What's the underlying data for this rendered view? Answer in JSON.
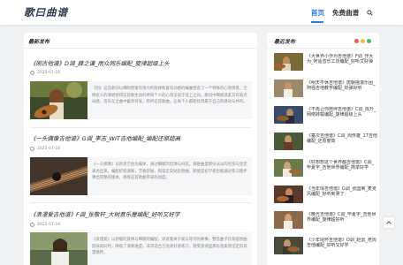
{
  "header": {
    "logo": "歌曰曲谱",
    "nav_home": "首页",
    "nav_free": "免费曲谱"
  },
  "main": {
    "section_title": "最新发布",
    "posts": [
      {
        "title": "《刚古他谱》D调_薛之谦_雨众同乐编配_旋律超级上头",
        "date": "2025-07-16",
        "excerpt": "《别》这首歌词以细的而富有张力的旋律和富有动感的编曲营造了一个特殊的心境情景，全情投入的演唱使得这首歌生动的将每个人的心境呈现于弦上之间。歌词中细腻温柔又有鼓点动感，音乐在全曲中蓄势待发。聆听这首歌曲，让每个人都能找到属于自己的感动与共鸣。"
      },
      {
        "title": "《一头偶像吉他谱》G调_李志_WIT吉他编配_编配还原超高",
        "date": "2025-07-16",
        "excerpt": "《一头偶像》以民谣吉他为载体，通过细腻的指弹与扫弦，将歌曲里那份淡淡的忧伤与坚定表达出来。编配结构清晰，节奏舒展，和弦走向贴近原曲，即使是初学者也能通过练习逐步弹出完整的版本，感受这首歌曲带来的温度。"
      },
      {
        "title": "《浪漫爱吉他谱》F调_张敬轩_大树音乐屋编配_好听又好学",
        "date": "2025-07-16",
        "excerpt": "《浪漫爱》以舒缓的旋律与细腻的编配，诉说着关于爱与等待的故事。整首曲子在保留原曲韵味的同时，降低了演奏难度，非常适合吉他爱好者练习，感受旋律里那份温柔而坚定的浪漫情怀。"
      }
    ]
  },
  "sidebar": {
    "section_title": "最近发布",
    "dot_colors": [
      "#f05a50",
      "#f5b940",
      "#37c665"
    ],
    "items": [
      {
        "title": "《大世界小作为吉他谱》F调_作大为_阿遥音乐工坊编配_好听又好弹"
      },
      {
        "title": "《明天不休吉他谱》唐朝摇滚乐团_阿强吉他教学编配_好弹好听"
      },
      {
        "title": "《不再让你陪伴吉他谱》C调_陈升_网络转载编配_旋律超级上头"
      },
      {
        "title": "《童次吉他谱》C调_周传雄_17吉他编配_还原度高"
      },
      {
        "title": "《好想想这个世界都吉他谱》C调_毕夏宇_吉他世界编配_简单好学"
      },
      {
        "title": "《当年情吉他谱》G调_张国荣_麦克风编配_好听到哭了"
      },
      {
        "title": "《晚光吉他谱》C调_毕夏宇_吉他世界编配_旋律超好听"
      },
      {
        "title": "《少年情怀吉他谱》D调_赵雷_老周吉他编配_好听又好学"
      }
    ]
  }
}
